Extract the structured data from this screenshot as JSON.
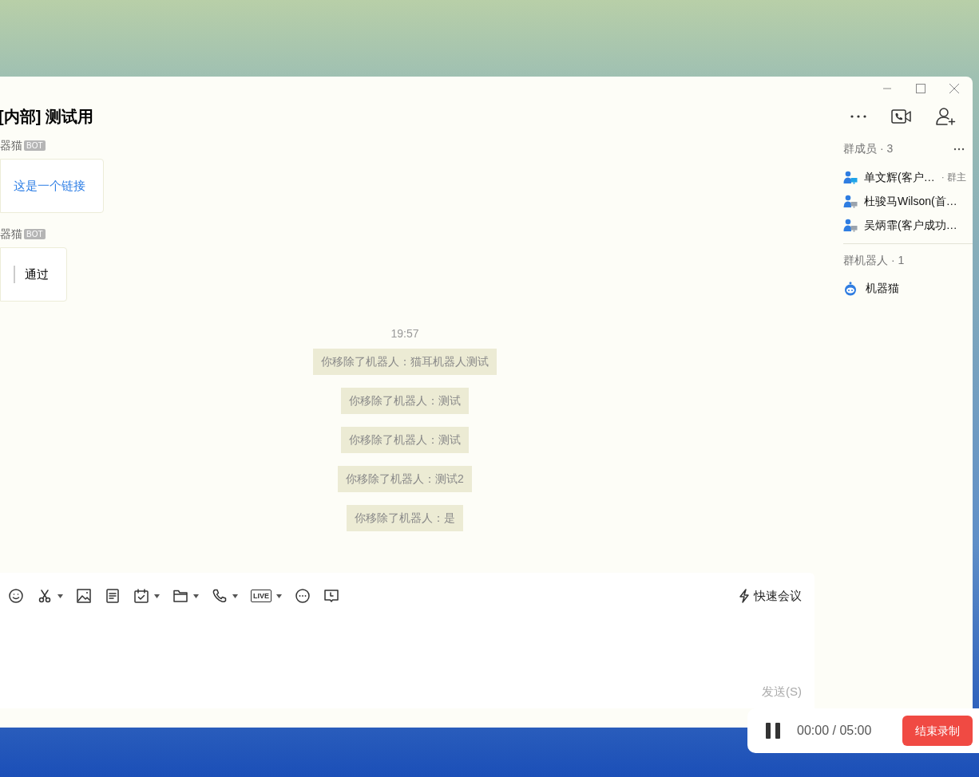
{
  "window": {
    "title": "[内部] 测试用"
  },
  "messages": [
    {
      "sender": "器猫",
      "badge": "BOT",
      "kind": "link",
      "text": "这是一个链接"
    },
    {
      "sender": "器猫",
      "badge": "BOT",
      "kind": "quote",
      "text": "通过"
    }
  ],
  "time": "19:57",
  "notices": [
    "你移除了机器人：猫耳机器人测试",
    "你移除了机器人：测试",
    "你移除了机器人：测试",
    "你移除了机器人：测试2",
    "你移除了机器人：是"
  ],
  "toolbar": [
    {
      "kind": "emoji",
      "dropdown": false
    },
    {
      "kind": "scissors",
      "dropdown": true
    },
    {
      "kind": "image",
      "dropdown": false
    },
    {
      "kind": "doc",
      "dropdown": false
    },
    {
      "kind": "calendar",
      "dropdown": true
    },
    {
      "kind": "folder",
      "dropdown": true
    },
    {
      "kind": "phone",
      "dropdown": true
    },
    {
      "kind": "live",
      "label": "LIVE",
      "dropdown": true
    },
    {
      "kind": "more",
      "dropdown": false
    },
    {
      "kind": "clock",
      "dropdown": false
    }
  ],
  "quick_meeting": "快速会议",
  "send": "发送(S)",
  "sidebar": {
    "members_title": "群成员 · 3",
    "members": [
      {
        "name": "单文辉(客户…",
        "role": "· 群主",
        "online": true
      },
      {
        "name": "杜骏马Wilson(首…",
        "online": false
      },
      {
        "name": "吴炳霏(客户成功…",
        "online": false
      }
    ],
    "bots_title": "群机器人 · 1",
    "bots": [
      {
        "name": "机器猫"
      }
    ]
  },
  "recording": {
    "elapsed": "00:00 / 05:00",
    "stop": "结束录制"
  }
}
